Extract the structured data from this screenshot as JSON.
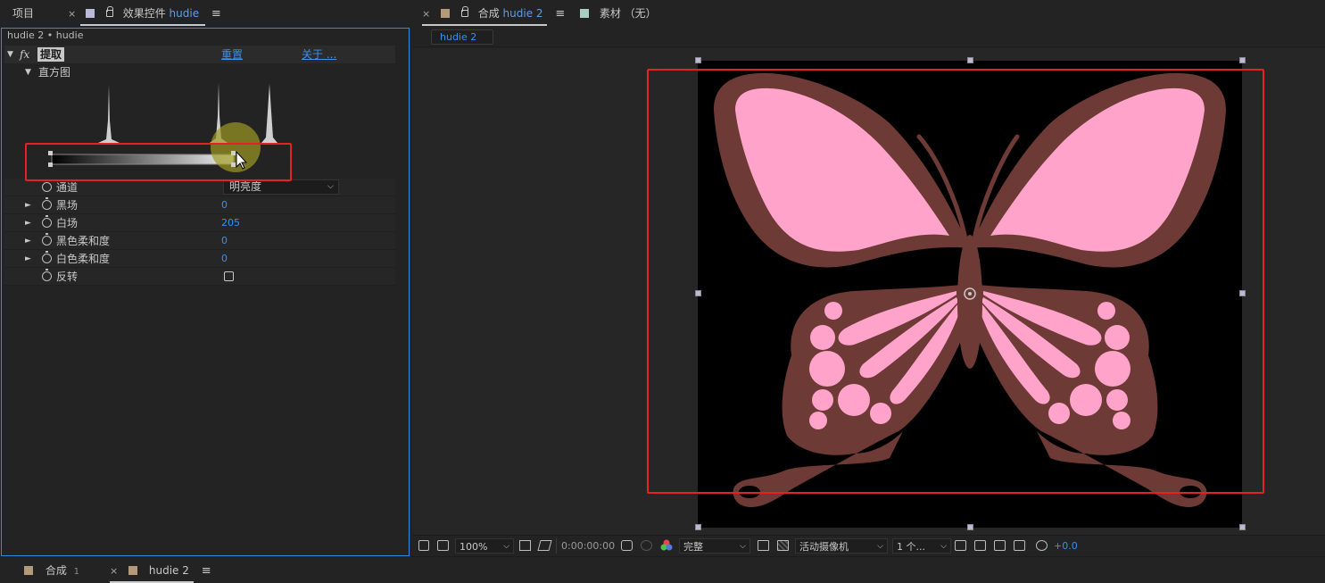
{
  "left_panel": {
    "tabs": [
      {
        "label": "项目"
      },
      {
        "close": "×",
        "prefix": "效果控件",
        "layer": "hudie",
        "menu": "≡"
      }
    ],
    "layer_path": "hudie 2 • hudie",
    "effect": {
      "fx": "fx",
      "name": "提取",
      "reset": "重置",
      "about": "关于 ...",
      "histogram_label": "直方图",
      "histogram": {
        "black_point": 0,
        "white_point": 205
      },
      "properties": [
        {
          "label": "通道",
          "value": "明亮度",
          "kind": "dropdown"
        },
        {
          "label": "黑场",
          "value": "0"
        },
        {
          "label": "白场",
          "value": "205"
        },
        {
          "label": "黑色柔和度",
          "value": "0"
        },
        {
          "label": "白色柔和度",
          "value": "0"
        },
        {
          "label": "反转",
          "value": "",
          "kind": "checkbox",
          "checked": false
        }
      ]
    }
  },
  "right_panel": {
    "comp_tab": {
      "close": "×",
      "prefix": "合成",
      "name": "hudie 2",
      "menu": "≡"
    },
    "footage_tab": {
      "label": "素材 （无）"
    },
    "comp_chip": "hudie 2",
    "toolbar": {
      "zoom": "100%",
      "timecode": "0:00:00:00",
      "resolution": "完整",
      "camera": "活动摄像机",
      "views": "1 个...",
      "exposure": "+0.0"
    }
  },
  "timeline_tabs": [
    {
      "label": "合成",
      "sub": "1"
    },
    {
      "close": "×",
      "label": "hudie 2",
      "menu": "≡"
    }
  ],
  "colors": {
    "accent_blue": "#3a8ff0",
    "highlight_red": "#e32222",
    "wing_pink": "#ffa3cb",
    "wing_brown": "#6e3a36"
  }
}
